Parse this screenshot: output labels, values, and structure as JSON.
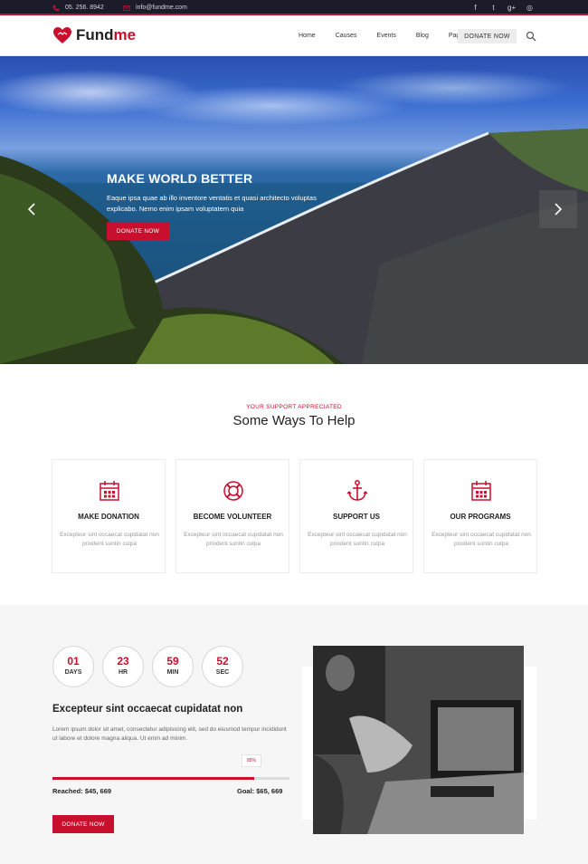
{
  "colors": {
    "accent": "#c8102e",
    "topbar": "#1b1b2a"
  },
  "topbar": {
    "phone": "05. 256. 8942",
    "email": "info@fundme.com",
    "social": [
      {
        "icon": "facebook-icon",
        "glyph": "f"
      },
      {
        "icon": "twitter-icon",
        "glyph": "t"
      },
      {
        "icon": "google-plus-icon",
        "glyph": "g+"
      },
      {
        "icon": "instagram-icon",
        "glyph": "◎"
      }
    ]
  },
  "header": {
    "logo_main": "Fund",
    "logo_accent": "me",
    "nav": [
      "Home",
      "Causes",
      "Events",
      "Blog",
      "Pages"
    ],
    "donate_label": "DONATE NOW"
  },
  "hero": {
    "title": "MAKE WORLD BETTER",
    "text": "Eaque ipsa quae ab illo inventore ventatis et quasi architecto voluptas explicabo. Nemo enim ipsam voluptatem quia",
    "button": "DONATE NOW"
  },
  "help": {
    "subtitle": "YOUR SUPPORT APPRECIATED",
    "title": "Some Ways To Help",
    "cards": [
      {
        "icon": "calendar-icon",
        "title": "MAKE DONATION",
        "text": "Excepteur sint occaecat cupidatat non proident suntin culpa"
      },
      {
        "icon": "lifebuoy-icon",
        "title": "BECOME VOLUNTEER",
        "text": "Excepteur sint occaecat cupidatat non proident suntin culpa"
      },
      {
        "icon": "anchor-icon",
        "title": "SUPPORT US",
        "text": "Excepteur sint occaecat cupidatat non proident suntin culpa"
      },
      {
        "icon": "calendar-icon",
        "title": "OUR PROGRAMS",
        "text": "Excepteur sint occaecat cupidatat non proident suntin culpa"
      }
    ]
  },
  "cause": {
    "countdown": [
      {
        "value": "01",
        "label": "DAYS"
      },
      {
        "value": "23",
        "label": "HR"
      },
      {
        "value": "59",
        "label": "MIN"
      },
      {
        "value": "52",
        "label": "SEC"
      }
    ],
    "title": "Excepteur sint occaecat cupidatat non",
    "text": "Lorem ipsum dolor sit amet, consectetur adipisicing elit, sed do eiusmod tempur incididunt ut labore et dolore magna aliqua. Ut enim ad minim.",
    "progress_label": "85%",
    "progress": 0.85,
    "reached": "Reached: $45, 669",
    "goal": "Goal: $65, 669",
    "button": "DONATE NOW"
  }
}
